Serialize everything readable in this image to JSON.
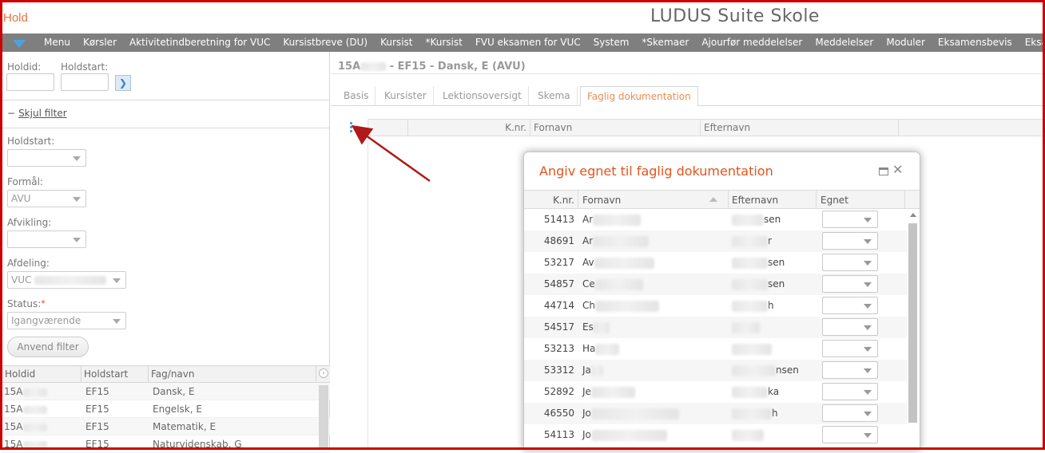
{
  "app": {
    "section_title": "Hold",
    "suite_title": "LUDUS Suite Skole"
  },
  "menu": {
    "items": [
      "Menu",
      "Kørsler",
      "Aktivitetindberetning for VUC",
      "Kursistbreve (DU)",
      "Kursist",
      "*Kursist",
      "FVU eksamen for VUC",
      "System",
      "*Skemaer",
      "Ajourfør meddelelser",
      "Meddelelser",
      "Moduler",
      "Eksamensbevis",
      "Eksamensp"
    ]
  },
  "search": {
    "holdid_label": "Holdid:",
    "holdstart_label": "Holdstart:",
    "go_glyph": "❯"
  },
  "filter": {
    "toggle_glyph": "−",
    "toggle_label": "Skjul filter",
    "holdstart_label": "Holdstart:",
    "formal_label": "Formål:",
    "formal_value": "AVU",
    "afvikling_label": "Afvikling:",
    "afdeling_label": "Afdeling:",
    "afdeling_value": "VUC",
    "status_label": "Status:",
    "status_required": "*",
    "status_value": "Igangværende",
    "apply_button": "Anvend filter"
  },
  "hold_table": {
    "columns": [
      "Holdid",
      "Holdstart",
      "Fag/navn"
    ],
    "rows": [
      {
        "holdid": "15A",
        "holdstart": "EF15",
        "fag": "Dansk, E"
      },
      {
        "holdid": "15A",
        "holdstart": "EF15",
        "fag": "Engelsk, E"
      },
      {
        "holdid": "15A",
        "holdstart": "EF15",
        "fag": "Matematik, E"
      },
      {
        "holdid": "15A",
        "holdstart": "EF15",
        "fag": "Naturvidenskab, G"
      }
    ]
  },
  "detail": {
    "breadcrumb_prefix": "15A",
    "breadcrumb_suffix": " - EF15 - Dansk, E (AVU)",
    "tabs": [
      "Basis",
      "Kursister",
      "Lektionsoversigt",
      "Skema",
      "Faglig dokumentation"
    ],
    "active_tab": "Faglig dokumentation",
    "grid_columns": [
      "K.nr.",
      "Fornavn",
      "Efternavn"
    ]
  },
  "modal": {
    "title": "Angiv egnet til faglig dokumentation",
    "columns": [
      "K.nr.",
      "Fornavn",
      "Efternavn",
      "Egnet"
    ],
    "rows": [
      {
        "knr": "51413",
        "fornavn": "Ar",
        "efternavn_suffix": "sen",
        "egnet": ""
      },
      {
        "knr": "48691",
        "fornavn": "Ar",
        "efternavn_suffix": "r",
        "egnet": ""
      },
      {
        "knr": "53217",
        "fornavn": "Av",
        "efternavn_suffix": "sen",
        "egnet": ""
      },
      {
        "knr": "54857",
        "fornavn": "Ce",
        "efternavn_suffix": "sen",
        "egnet": ""
      },
      {
        "knr": "44714",
        "fornavn": "Ch",
        "efternavn_suffix": "h",
        "egnet": ""
      },
      {
        "knr": "54517",
        "fornavn": "Es",
        "efternavn_suffix": "",
        "egnet": ""
      },
      {
        "knr": "53213",
        "fornavn": "Ha",
        "efternavn_suffix": "",
        "egnet": ""
      },
      {
        "knr": "53312",
        "fornavn": "Ja",
        "efternavn_suffix": "nsen",
        "egnet": ""
      },
      {
        "knr": "52892",
        "fornavn": "Je",
        "efternavn_suffix": "ka",
        "egnet": ""
      },
      {
        "knr": "46550",
        "fornavn": "Jo",
        "efternavn_suffix": "h",
        "egnet": ""
      },
      {
        "knr": "54113",
        "fornavn": "Jo",
        "efternavn_suffix": "",
        "egnet": ""
      }
    ]
  },
  "colors": {
    "frame": "#cc0000",
    "accent_orange": "#e8733a",
    "menubar": "#7f7f7f",
    "annotation_arrow": "#b11a1a",
    "modal_title": "#e2541d"
  },
  "icons": {
    "menu_toggle": "triangle-down-icon",
    "maximize": "maximize-icon",
    "close": "close-icon",
    "kebab": "vertical-dots-icon",
    "go": "chevron-right-icon"
  }
}
